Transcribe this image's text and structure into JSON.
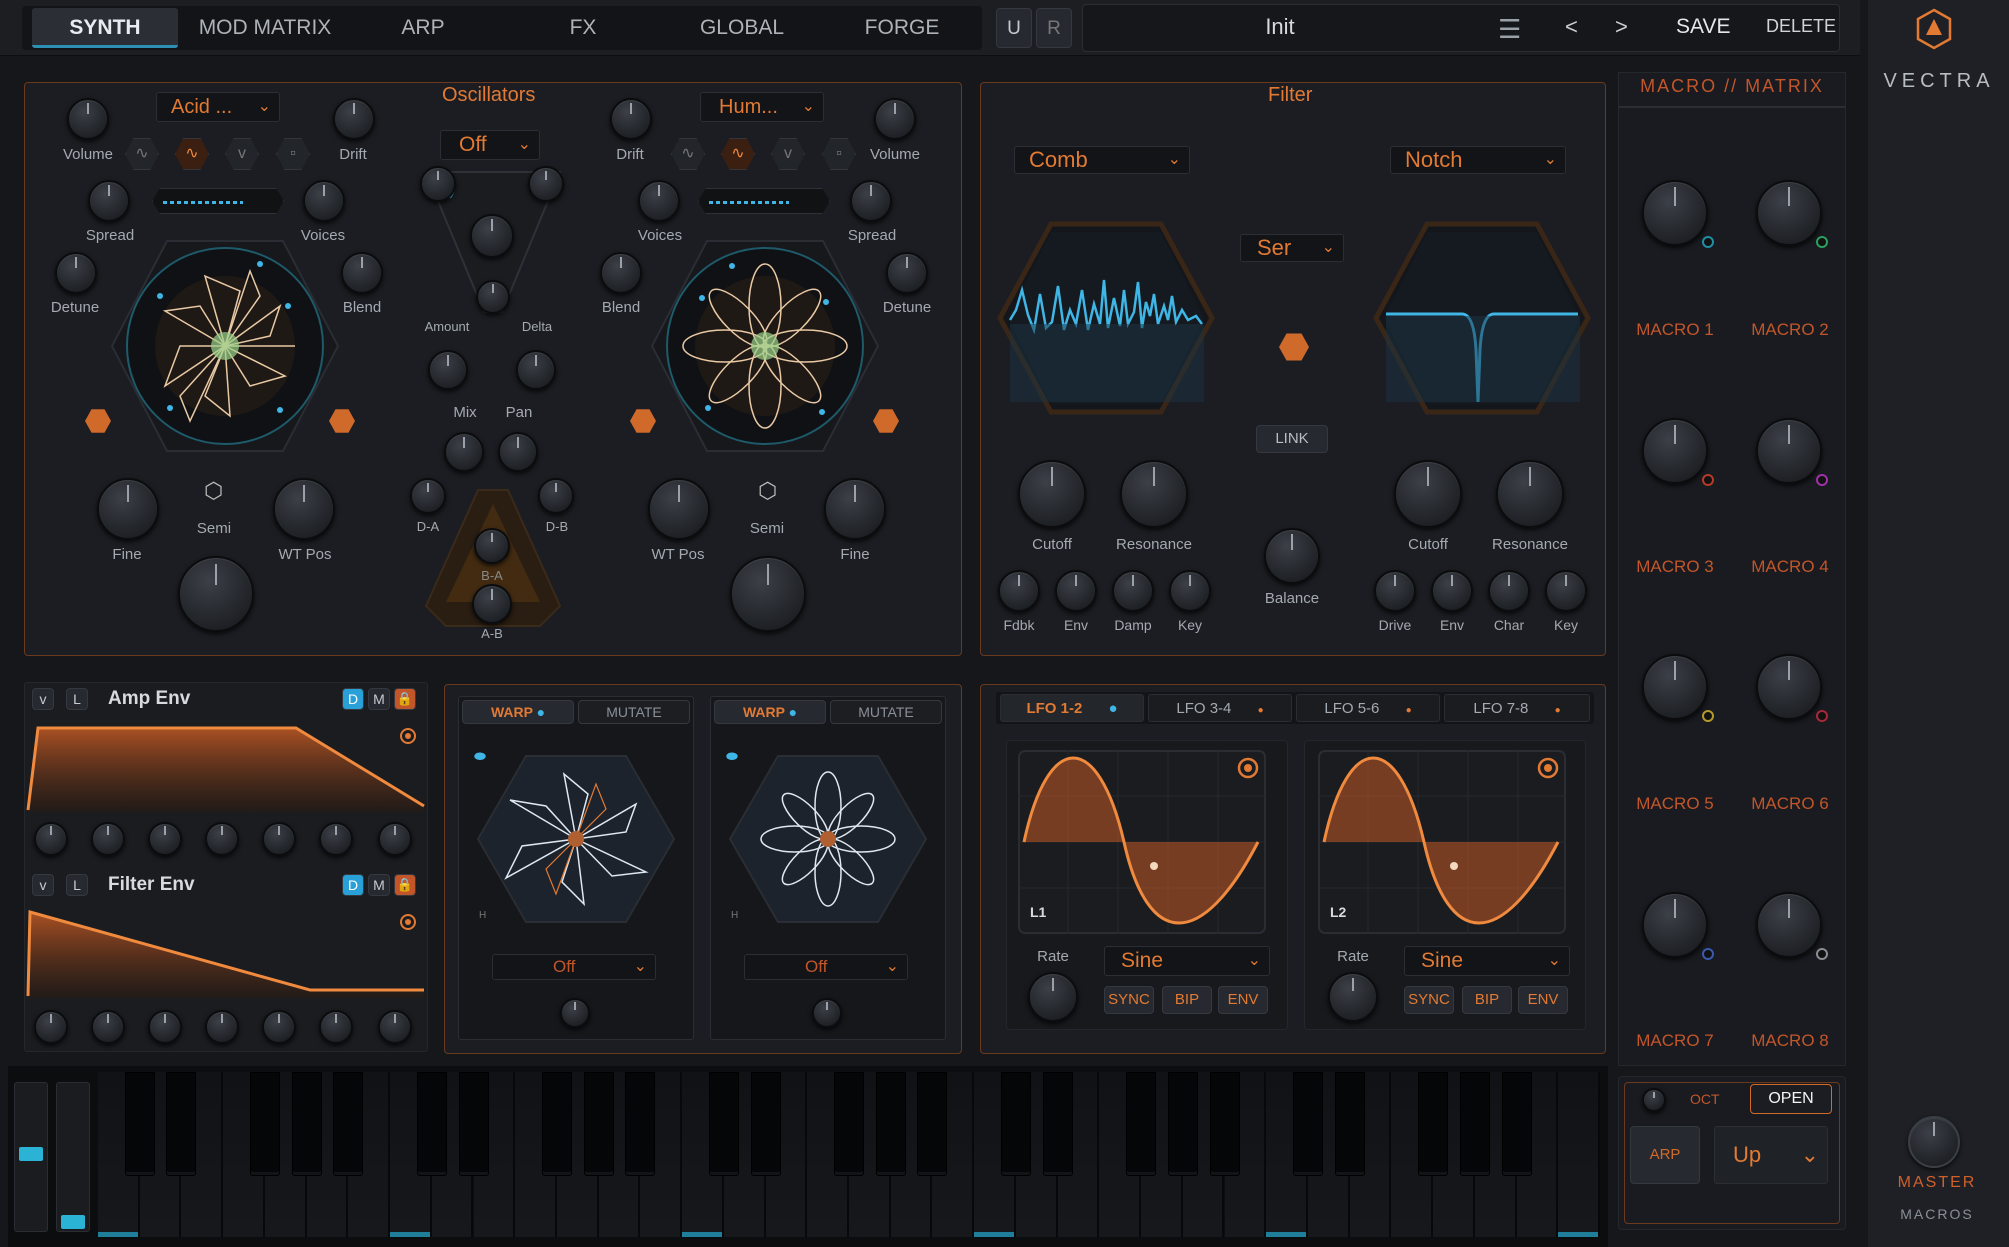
{
  "top_tabs": [
    "SYNTH",
    "MOD MATRIX",
    "ARP",
    "FX",
    "GLOBAL",
    "FORGE"
  ],
  "active_tab": "SYNTH",
  "ur": [
    "U",
    "R"
  ],
  "preset": "Init",
  "hdr": {
    "menu_icon": "hamburger-menu-icon",
    "prev": "<",
    "next": ">",
    "save": "SAVE",
    "delete": "DELETE"
  },
  "brand": "VECTRA",
  "osc": {
    "title": "Oscillators",
    "a": {
      "wavetable": "Acid ...",
      "volume": "Volume",
      "drift": "Drift",
      "spread": "Spread",
      "voices": "Voices",
      "detune": "Detune",
      "blend": "Blend",
      "fine": "Fine",
      "semi": "Semi",
      "wtpos": "WT Pos"
    },
    "b": {
      "wavetable": "Hum...",
      "volume": "Volume",
      "drift": "Drift",
      "spread": "Spread",
      "voices": "Voices",
      "detune": "Detune",
      "blend": "Blend",
      "fine": "Fine",
      "semi": "Semi",
      "wtpos": "WT Pos"
    },
    "mix_mode": "Off",
    "amount": "Amount",
    "delta": "Delta",
    "mix": "Mix",
    "pan": "Pan",
    "da": "D-A",
    "db": "D-B",
    "ba": "B-A",
    "ab": "A-B"
  },
  "filter": {
    "title": "Filter",
    "f1_type": "Comb",
    "f2_type": "Notch",
    "routing": "Ser",
    "link": "LINK",
    "cutoff": "Cutoff",
    "resonance": "Resonance",
    "balance": "Balance",
    "f1_small": [
      "Fdbk",
      "Env",
      "Damp",
      "Key"
    ],
    "f2_small": [
      "Drive",
      "Env",
      "Char",
      "Key"
    ]
  },
  "macros": {
    "title": "MACRO // MATRIX",
    "names": [
      "MACRO 1",
      "MACRO 2",
      "MACRO 3",
      "MACRO 4",
      "MACRO 5",
      "MACRO 6",
      "MACRO 7",
      "MACRO 8"
    ],
    "dot_colors": [
      "#1f8fa6",
      "#2aa060",
      "#b53a2a",
      "#a030a8",
      "#b59a2a",
      "#a8283a",
      "#3a5ab0",
      "#8a8e94"
    ]
  },
  "env": {
    "v": "v",
    "l": "L",
    "d": "D",
    "m": "M",
    "amp": "Amp Env",
    "filt": "Filter Env"
  },
  "warp": {
    "warp": "WARP",
    "mutate": "MUTATE",
    "h": "H",
    "mode_a": "Off",
    "mode_b": "Off"
  },
  "lfo": {
    "tabs": [
      "LFO 1-2",
      "LFO 3-4",
      "LFO 5-6",
      "LFO 7-8"
    ],
    "active": "LFO 1-2",
    "l1": "L1",
    "l2": "L2",
    "rate": "Rate",
    "shape1": "Sine",
    "shape2": "Sine",
    "sync": "SYNC",
    "bip": "BIP",
    "env": "ENV"
  },
  "arp": {
    "oct": "OCT",
    "open": "OPEN",
    "arp": "ARP",
    "mode": "Up"
  },
  "master": {
    "label": "MASTER",
    "sub": "MACROS"
  },
  "colors": {
    "accent": "#e27a34",
    "cyan": "#3fb6e6",
    "bg": "#15171b",
    "panel_border": "#6b3a1e"
  }
}
